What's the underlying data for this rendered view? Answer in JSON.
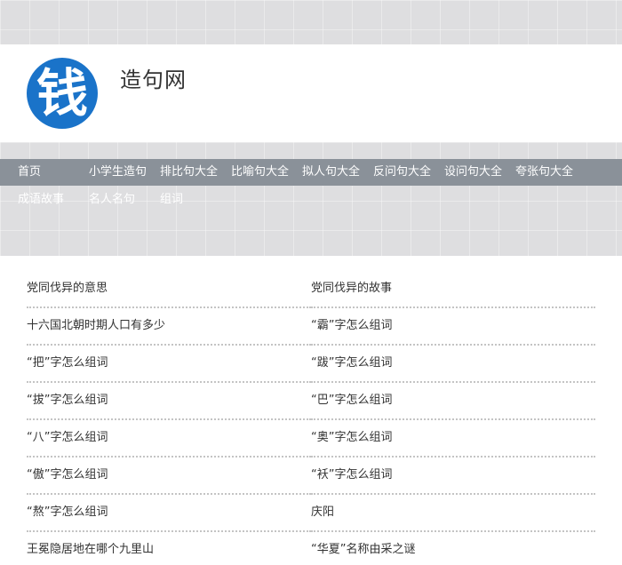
{
  "site": {
    "logo_char": "钱",
    "title": "造句网",
    "brand_color": "#1a73c9"
  },
  "nav": {
    "row1": [
      "首页",
      "小学生造句",
      "排比句大全",
      "比喻句大全",
      "拟人句大全",
      "反问句大全",
      "设问句大全",
      "夸张句大全"
    ],
    "row2": [
      "成语故事",
      "名人名句",
      "组词"
    ]
  },
  "articles": [
    [
      "党同伐异的意思",
      "党同伐异的故事"
    ],
    [
      "十六国北朝时期人口有多少",
      "“霸”字怎么组词"
    ],
    [
      "“把”字怎么组词",
      "“跋”字怎么组词"
    ],
    [
      "“拔”字怎么组词",
      "“巴”字怎么组词"
    ],
    [
      "“八”字怎么组词",
      "“奥”字怎么组词"
    ],
    [
      "“傲”字怎么组词",
      "“袄”字怎么组词"
    ],
    [
      "“熬”字怎么组词",
      "庆阳"
    ],
    [
      "王冕隐居地在哪个九里山",
      "“华夏”名称由采之谜"
    ]
  ]
}
